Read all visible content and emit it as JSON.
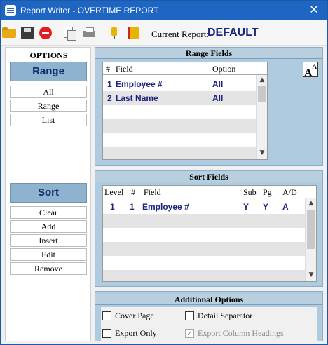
{
  "window": {
    "title": "Report Writer - OVERTIME REPORT",
    "close_glyph": "✕"
  },
  "toolbar": {
    "icons": [
      "open-folder-icon",
      "save-disk-icon",
      "stop-icon",
      "copy-icon",
      "print-icon",
      "plugin-icon",
      "book-icon"
    ],
    "current_report_label": "Current Report:",
    "current_report_value": "DEFAULT"
  },
  "options": {
    "title": "OPTIONS",
    "range_label": "Range",
    "range_buttons": [
      "All",
      "Range",
      "List"
    ],
    "sort_label": "Sort",
    "sort_buttons": [
      "Clear",
      "Add",
      "Insert",
      "Edit",
      "Remove"
    ]
  },
  "range_fields": {
    "title": "Range  Fields",
    "columns": [
      "#",
      "Field",
      "Option"
    ],
    "rows": [
      {
        "num": "1",
        "field": "Employee #",
        "option": "All"
      },
      {
        "num": "2",
        "field": "Last Name",
        "option": "All"
      }
    ],
    "font_button": "A"
  },
  "sort_fields": {
    "title": "Sort Fields",
    "columns": [
      "Level",
      "#",
      "Field",
      "Sub",
      "Pg",
      "A/D"
    ],
    "rows": [
      {
        "level": "1",
        "num": "1",
        "field": "Employee #",
        "sub": "Y",
        "pg": "Y",
        "ad": "A"
      }
    ]
  },
  "additional_options": {
    "title": "Additional Options",
    "cover_page": {
      "label": "Cover Page",
      "checked": false
    },
    "detail_separator": {
      "label": "Detail Separator",
      "checked": false
    },
    "export_only": {
      "label": "Export Only",
      "checked": false
    },
    "export_column_headings": {
      "label": "Export Column Headings",
      "checked": true,
      "disabled": true
    }
  },
  "colors": {
    "titlebar": "#1f66c2",
    "panel": "#aecbe0",
    "button": "#8fb3cf",
    "accent_text": "#1a237e"
  }
}
